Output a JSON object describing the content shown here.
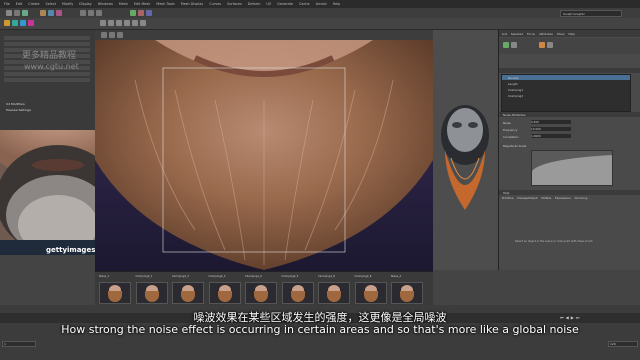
{
  "menubar": {
    "items": [
      "File",
      "Edit",
      "Create",
      "Select",
      "Modify",
      "Display",
      "Windows",
      "Mesh",
      "Edit Mesh",
      "Mesh Tools",
      "Mesh Display",
      "Curves",
      "Surfaces",
      "Deform",
      "UV",
      "Generate",
      "Cache",
      "Arnold",
      "Help"
    ],
    "workspace": "Sculpt Graphic"
  },
  "left_panel": {
    "rows": [
      "XGen Ds Scale",
      "",
      "",
      "",
      "",
      "",
      "",
      ""
    ],
    "sections": [
      "Ud Modifiers",
      "Preview Settings"
    ]
  },
  "watermark": {
    "line1": "更多精品教程",
    "line2": "www.cgtu.net"
  },
  "getty": {
    "label": "gettyimages"
  },
  "right_panel": {
    "tabs": [
      "List",
      "Selected",
      "Focus",
      "Attributes",
      "Show",
      "Help"
    ],
    "tree_items": [
      "Density",
      "Length",
      "Clumping1",
      "Clumping2"
    ],
    "fields": [
      {
        "label": "Noise",
        "value": "0.500"
      },
      {
        "label": "Frequency",
        "value": "10.000"
      },
      {
        "label": "Correlation",
        "value": "1.0000"
      },
      {
        "label": "Magnitude Scale",
        "value": ""
      }
    ],
    "section_header": "Noise Attributes",
    "section_header2": "Help",
    "lower_tabs": [
      "Primitive",
      "Preview/Output",
      "Utilities",
      "Expressions",
      "Grooming"
    ],
    "hint": "Select an object in the scene or click point with XGen brush"
  },
  "timeline": {
    "labels": [
      "Noise_1",
      "Clumping2_1",
      "Clumping1_3",
      "Clumping2_3",
      "Clumping1_6",
      "Clumping2_5",
      "Clumping1_8",
      "Clumping2_8",
      "Noise_2"
    ]
  },
  "subtitles": {
    "cn": "噪波效果在某些区域发生的强度，这更像是全局噪波",
    "en": "How strong the noise effect is occurring in certain areas and so that's more like a global noise"
  },
  "status": {
    "frame": "1",
    "end": "120"
  }
}
